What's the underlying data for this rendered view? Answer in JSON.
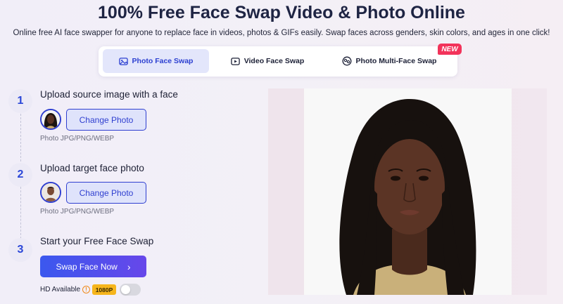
{
  "header": {
    "title": "100% Free Face Swap Video & Photo Online",
    "subtitle": "Online free AI face swapper for anyone to replace face in videos, photos & GIFs easily. Swap faces across genders, skin colors, and ages in one click!"
  },
  "tabs": [
    {
      "label": "Photo Face Swap",
      "icon": "image-icon",
      "active": true
    },
    {
      "label": "Video Face Swap",
      "icon": "play-icon",
      "active": false
    },
    {
      "label": "Photo Multi-Face Swap",
      "icon": "multi-face-icon",
      "active": false
    }
  ],
  "new_badge": "NEW",
  "steps": [
    {
      "number": "1",
      "title": "Upload source image with a face",
      "button": "Change Photo",
      "hint": "Photo JPG/PNG/WEBP"
    },
    {
      "number": "2",
      "title": "Upload target face photo",
      "button": "Change Photo",
      "hint": "Photo JPG/PNG/WEBP"
    },
    {
      "number": "3",
      "title": "Start your Free Face Swap",
      "button": "Swap Face Now"
    }
  ],
  "hd": {
    "label": "HD Available",
    "resolution": "1080P",
    "enabled": false
  },
  "colors": {
    "accent": "#2f3fd0",
    "new_badge": "#f2335a",
    "hd_badge": "#f6b51c"
  }
}
